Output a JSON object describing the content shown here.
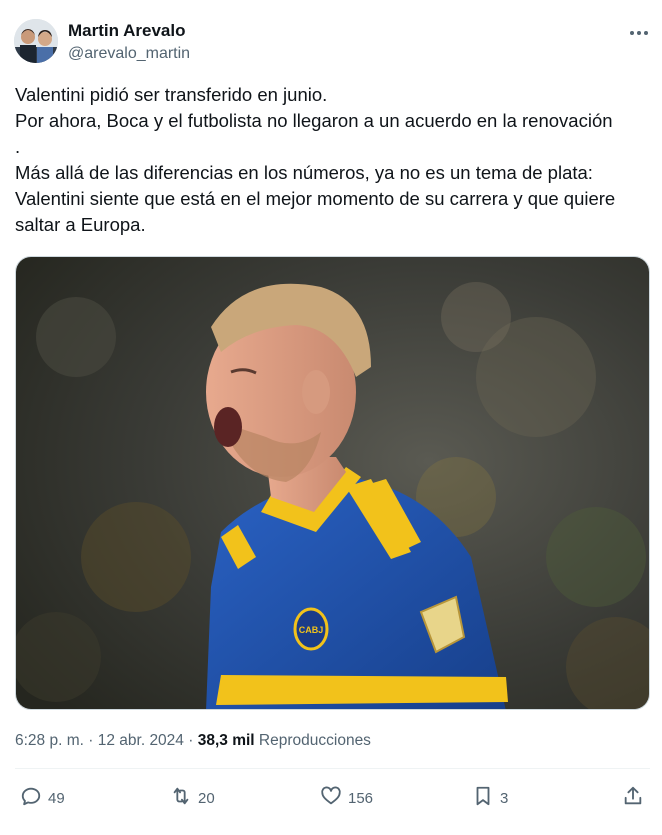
{
  "author": {
    "name": "Martin Arevalo",
    "handle": "@arevalo_martin"
  },
  "tweet": {
    "lines": [
      "Valentini pidió ser transferido en junio.",
      "Por ahora, Boca y el futbolista no llegaron a un acuerdo en la renovación",
      ".",
      "Más allá de las diferencias en los números, ya no es un tema de plata:",
      "Valentini siente que está en el mejor momento de su carrera y que quiere",
      "saltar a Europa."
    ]
  },
  "meta": {
    "time": "6:28 p. m.",
    "separator": "·",
    "date": "12 abr. 2024",
    "views_count": "38,3 mil",
    "views_label": "Reproducciones"
  },
  "actions": {
    "replies": "49",
    "reposts": "20",
    "likes": "156",
    "bookmarks": "3"
  },
  "icons": [
    "more-icon",
    "reply-icon",
    "repost-icon",
    "like-icon",
    "bookmark-icon",
    "share-icon"
  ],
  "colors": {
    "text": "#0f1419",
    "secondary": "#536471",
    "divider": "#eff3f4",
    "jersey_blue": "#1f4fa3",
    "jersey_yellow": "#f2c21b"
  }
}
